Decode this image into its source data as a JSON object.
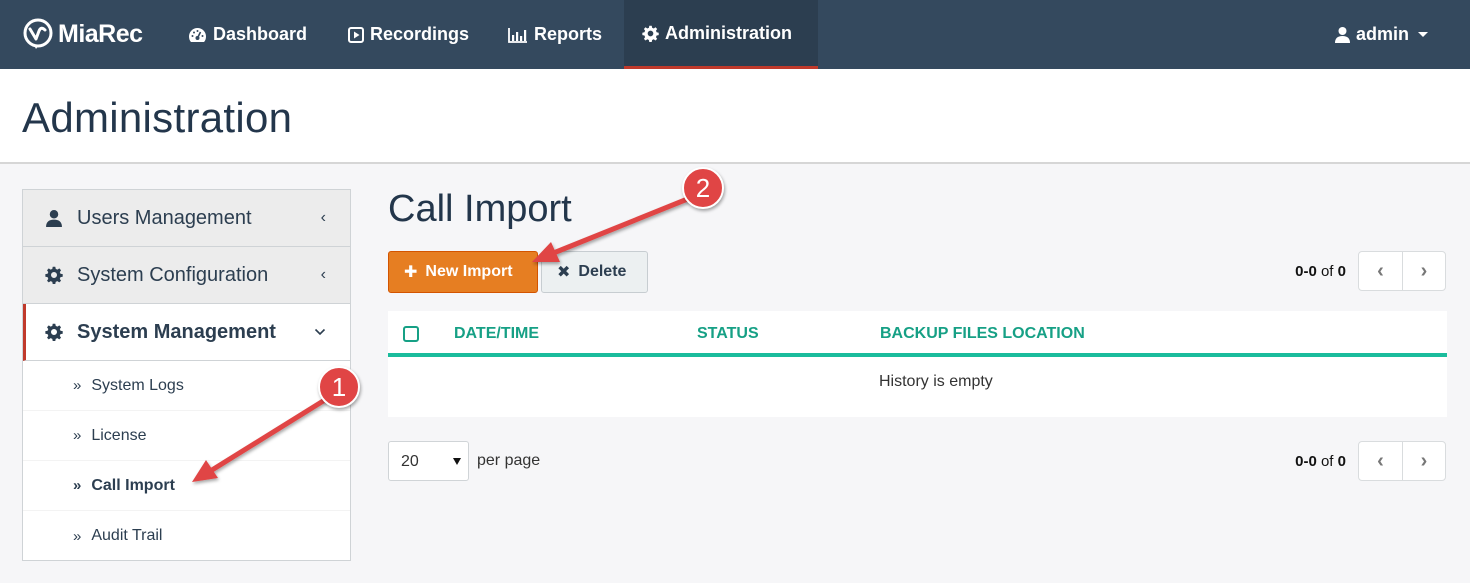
{
  "navbar": {
    "brand": "MiaRec",
    "items": [
      {
        "label": "Dashboard",
        "icon": "dashboard-icon"
      },
      {
        "label": "Recordings",
        "icon": "play-square-icon"
      },
      {
        "label": "Reports",
        "icon": "bar-chart-icon"
      },
      {
        "label": "Administration",
        "icon": "gear-icon",
        "active": true
      }
    ],
    "user": "admin"
  },
  "page": {
    "title": "Administration"
  },
  "sidebar": {
    "groups": [
      {
        "label": "Users Management",
        "icon": "user-icon",
        "chevron": "‹"
      },
      {
        "label": "System Configuration",
        "icon": "gear-icon",
        "chevron": "‹"
      },
      {
        "label": "System Management",
        "icon": "gear-icon",
        "chevron": "⌄",
        "active": true
      }
    ],
    "sub_items": [
      {
        "label": "System Logs"
      },
      {
        "label": "License"
      },
      {
        "label": "Call Import",
        "current": true
      },
      {
        "label": "Audit Trail"
      }
    ],
    "sub_marker": "»"
  },
  "main": {
    "title": "Call Import",
    "buttons": {
      "new_import": "New Import",
      "delete": "Delete"
    },
    "pager": {
      "range": "0-0",
      "of": "of",
      "total": "0",
      "prev": "‹",
      "next": "›"
    },
    "table": {
      "columns": [
        "DATE/TIME",
        "STATUS",
        "BACKUP FILES LOCATION"
      ],
      "empty_message": "History is empty"
    },
    "per_page": {
      "value": "20",
      "label": "per page"
    }
  },
  "annotations": {
    "step1": "1",
    "step2": "2",
    "color": "#e04545"
  },
  "colors": {
    "navbar": "#34495e",
    "navbar_active": "#2c3e50",
    "accent_red": "#c0392b",
    "primary_orange": "#e67e22",
    "table_accent": "#1abc9c",
    "table_header_text": "#16a085"
  }
}
